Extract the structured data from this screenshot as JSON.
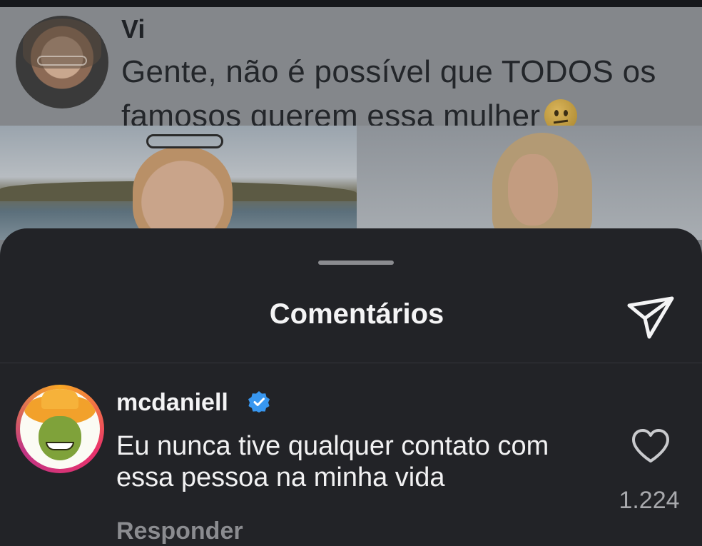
{
  "post": {
    "author_name": "Vi",
    "text": "Gente, não é possível que TODOS os famosos querem essa mulher",
    "emoji_icon": "neutral-face-emoji"
  },
  "sheet": {
    "title": "Comentários",
    "share_icon": "send-icon"
  },
  "comment": {
    "username": "mcdaniell",
    "verified_icon": "verified-badge-icon",
    "text": "Eu nunca tive qualquer contato com essa pessoa na minha vida",
    "like_icon": "heart-icon",
    "likes": "1.224",
    "reply_label": "Responder"
  },
  "colors": {
    "sheet_bg": "#222327",
    "verified_blue": "#3897f0",
    "muted_text": "#a8a9ad"
  }
}
